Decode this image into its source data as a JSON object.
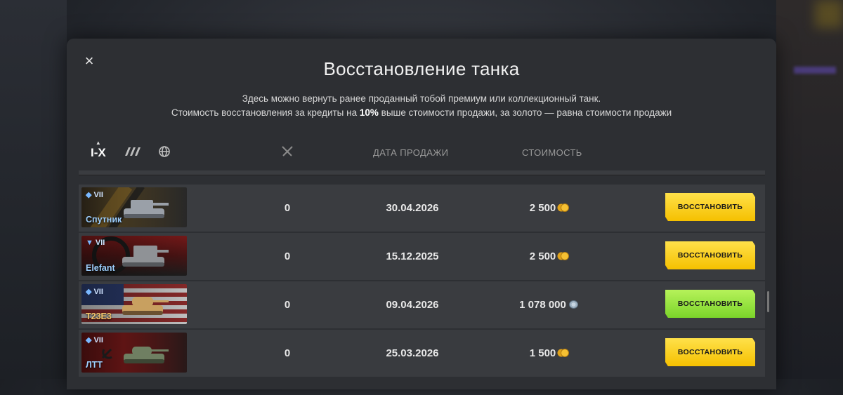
{
  "dialog": {
    "title": "Восстановление танка",
    "desc_line1": "Здесь можно вернуть ранее проданный тобой премиум или коллекционный танк.",
    "desc_line2_pre": "Стоимость восстановления за кредиты на ",
    "desc_line2_bold": "10%",
    "desc_line2_post": " выше стоимости продажи, за золото — равна стоимости продажи",
    "close_icon": "×"
  },
  "filters": {
    "tier_label": "I-X",
    "nation_icon": "nation-filter-icon",
    "world_icon": "globe-icon"
  },
  "columns": {
    "battles_icon": "crossed-swords-icon",
    "date": "ДАТА ПРОДАЖИ",
    "cost": "СТОИМОСТЬ"
  },
  "rows": [
    {
      "tier": "VII",
      "class_icon": "◆",
      "name": "Спутник",
      "name_color": "blue",
      "battles": "0",
      "date": "30.04.2026",
      "cost": "2 500",
      "currency": "gold",
      "button": "ВОССТАНОВИТЬ"
    },
    {
      "tier": "VII",
      "class_icon": "▼",
      "name": "Elefant",
      "name_color": "blue",
      "battles": "0",
      "date": "15.12.2025",
      "cost": "2 500",
      "currency": "gold",
      "button": "ВОССТАНОВИТЬ"
    },
    {
      "tier": "VII",
      "class_icon": "◆",
      "name": "T23E3",
      "name_color": "gold",
      "battles": "0",
      "date": "09.04.2026",
      "cost": "1 078 000",
      "currency": "credits",
      "button": "ВОССТАНОВИТЬ"
    },
    {
      "tier": "VII",
      "class_icon": "◆",
      "name": "ЛТТ",
      "name_color": "blue",
      "battles": "0",
      "date": "25.03.2026",
      "cost": "1 500",
      "currency": "gold",
      "button": "ВОССТАНОВИТЬ"
    }
  ],
  "colors": {
    "gold_button": "#f5c000",
    "credits_button": "#7bd42a",
    "panel": "#2d2f33"
  }
}
